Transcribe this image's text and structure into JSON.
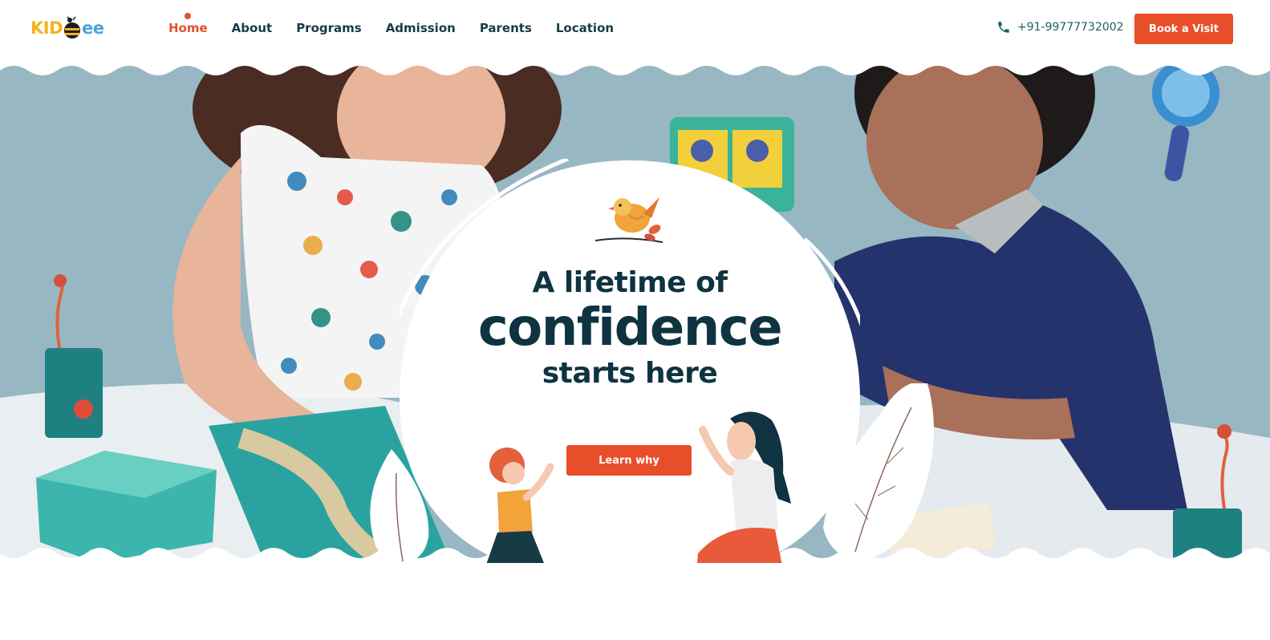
{
  "brand": {
    "logo_left": "KID",
    "logo_right": "ee"
  },
  "nav": {
    "items": [
      {
        "label": "Home",
        "active": true
      },
      {
        "label": "About",
        "active": false
      },
      {
        "label": "Programs",
        "active": false
      },
      {
        "label": "Admission",
        "active": false
      },
      {
        "label": "Parents",
        "active": false
      },
      {
        "label": "Location",
        "active": false
      }
    ]
  },
  "contact": {
    "phone": "+91-99777732002",
    "phone_icon": "phone-icon"
  },
  "header": {
    "cta_label": "Book a Visit"
  },
  "hero": {
    "line1": "A lifetime of",
    "line2": "confidence",
    "line3": "starts here",
    "cta_label": "Learn why"
  },
  "colors": {
    "accent": "#e84e2a",
    "heading": "#0f3340",
    "hero_bg": "#97b7c3",
    "logo_yellow": "#f6b11c",
    "logo_blue": "#4aa3df"
  }
}
